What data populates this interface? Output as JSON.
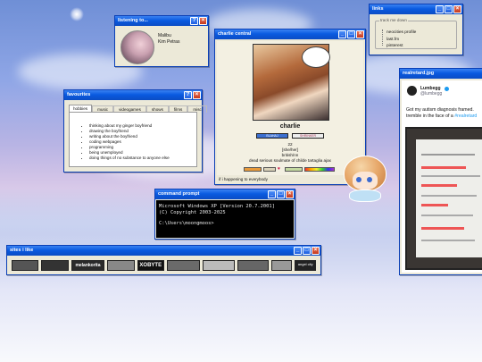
{
  "listening": {
    "title": "listening to...",
    "song": "Malibu",
    "artist": "Kim Petras"
  },
  "charlie": {
    "title": "charlie central",
    "name": "charlie",
    "badge1": "BLAHAJ",
    "badge2": "SHRINKER",
    "age": "22",
    "pronouns": "[she/her]",
    "identity": "british/nn",
    "bio": "dead serious soulmate of childe tartaglia ajax",
    "status": "if i happening to everybody"
  },
  "links": {
    "title": "links",
    "group": "track me down",
    "items": [
      "neocities profile",
      "last.fm",
      "pinterest"
    ]
  },
  "favourites": {
    "title": "favourites",
    "tabs": [
      "hobbies",
      "music",
      "videogames",
      "shows",
      "films",
      "misc"
    ],
    "items": [
      "thinking about my ginger boyfriend",
      "drawing the boyfriend",
      "writing about the boyfriend",
      "coding webpages",
      "programming",
      "being unemployed",
      "doing things of no substance to anyone else"
    ]
  },
  "cmd": {
    "title": "command prompt",
    "line1": "Microsoft Windows XP [Version 20.7.2001]",
    "line2": "(C) Copyright 2003-2025",
    "prompt": "C:\\Users\\moongmoos>"
  },
  "realretard": {
    "title": "realretard.jpg",
    "user": "Lumbegg",
    "handle": "@lumbegg",
    "tweet": "Got my autism diagnosis framed.",
    "tweet2": "tremble in the face of a",
    "hashtag": "#realretard"
  },
  "sites": {
    "title": "sites i like",
    "buttons": [
      "",
      "",
      "melankorita",
      "",
      "XOBYTE",
      "",
      "",
      "",
      "",
      "angel city"
    ]
  },
  "colors": {
    "title_blue": "#0a5ae0",
    "window_bg": "#ece9d8",
    "close_red": "#c4391e",
    "link_pink": "#e14fa0"
  }
}
